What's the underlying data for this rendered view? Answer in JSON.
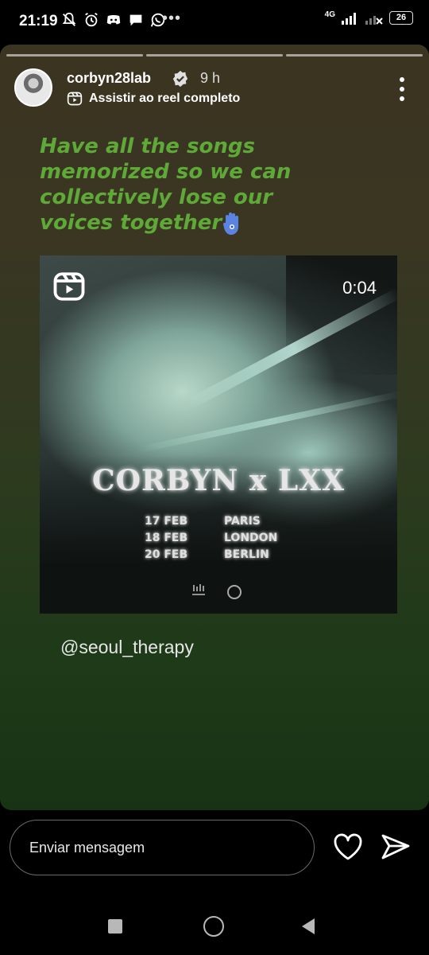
{
  "status_bar": {
    "time": "21:19",
    "network": "4G",
    "battery": "26",
    "icons": [
      "mute-bell-icon",
      "alarm-icon",
      "discord-icon",
      "chat-icon",
      "whatsapp-icon"
    ],
    "more": "•••"
  },
  "story": {
    "username": "corbyn28lab",
    "time_ago": "9 h",
    "reel_link_label": "Assistir ao reel completo",
    "caption_lines": [
      "Have all the songs",
      "memorized so we can",
      "collectively lose our",
      "voices together"
    ],
    "caption_color": "#5ea938",
    "progress_segments": 3
  },
  "reel": {
    "duration": "0:04",
    "poster_title": "CORBYN x LXX",
    "dates": [
      {
        "date": "17 FEB",
        "city": "PARIS"
      },
      {
        "date": "18 FEB",
        "city": "LONDON"
      },
      {
        "date": "20 FEB",
        "city": "BERLIN"
      }
    ]
  },
  "mention": "@seoul_therapy",
  "message_bar": {
    "placeholder": "Enviar mensagem"
  }
}
